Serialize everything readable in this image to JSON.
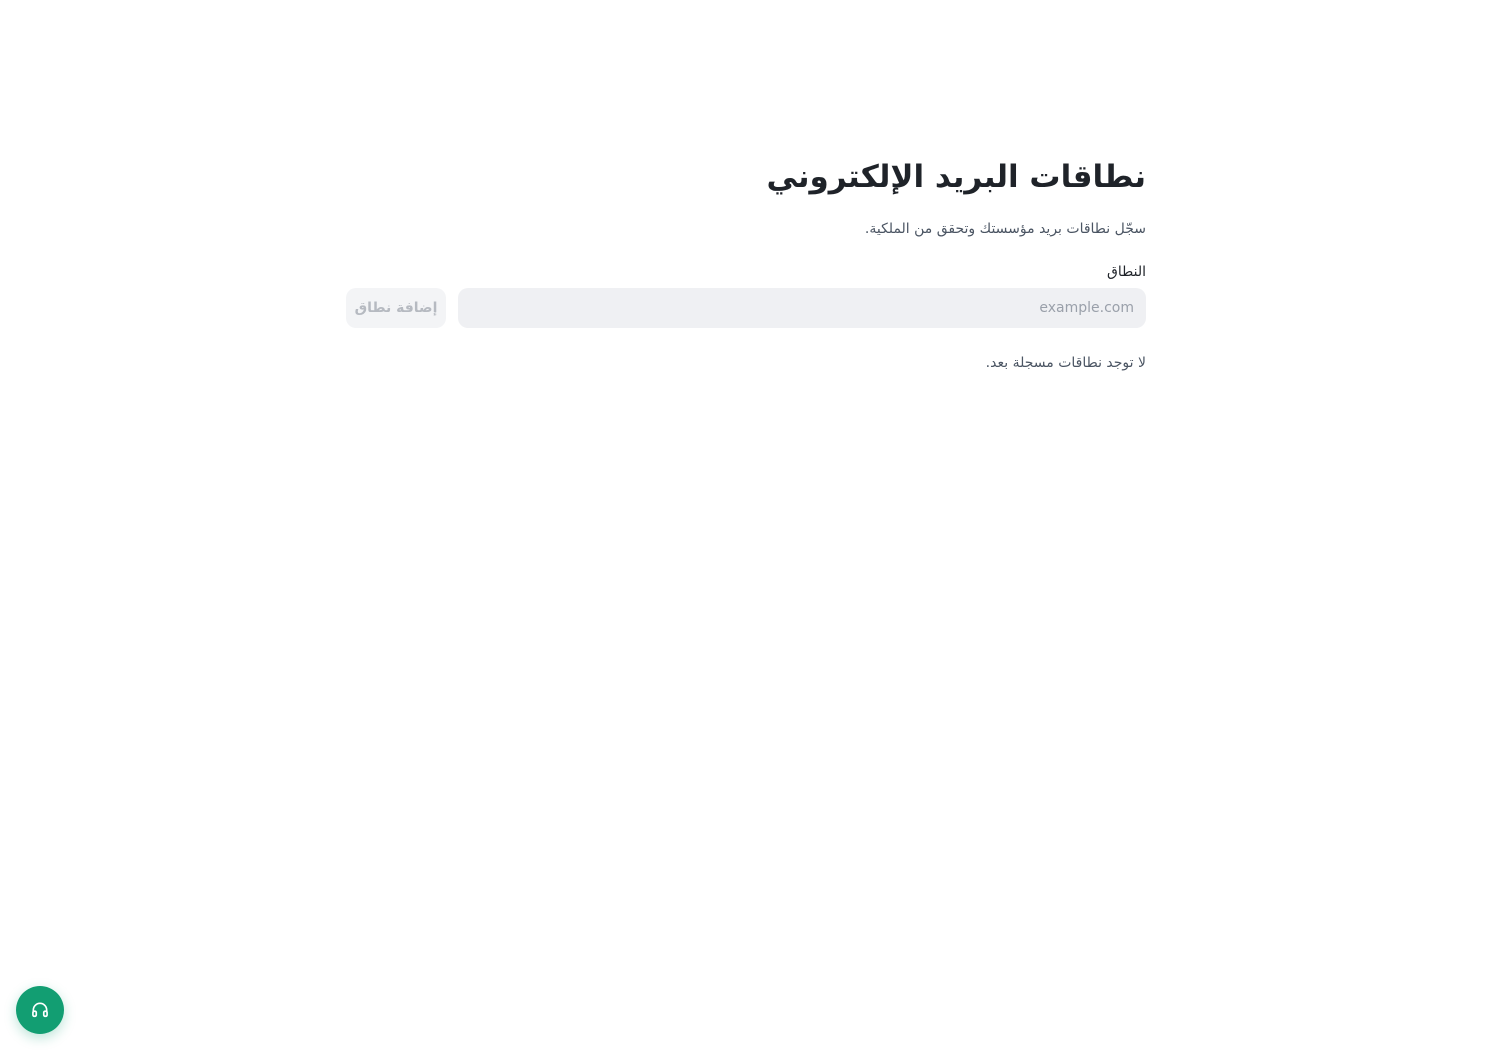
{
  "page": {
    "title": "نطاقات البريد الإلكتروني",
    "subtitle": "سجّل نطاقات بريد مؤسستك وتحقق من الملكية."
  },
  "form": {
    "domain_label": "النطاق",
    "domain_value": "",
    "domain_placeholder": "example.com",
    "add_button_label": "إضافة نطاق",
    "add_button_disabled": true
  },
  "domains_list": {
    "items": [],
    "empty_text": "لا توجد نطاقات مسجلة بعد."
  },
  "support": {
    "icon": "headphones-icon",
    "color": "#129e72"
  },
  "colors": {
    "input_background": "#eff0f3",
    "button_disabled_background": "#f3f4f6",
    "button_disabled_text": "#b6bac1"
  }
}
